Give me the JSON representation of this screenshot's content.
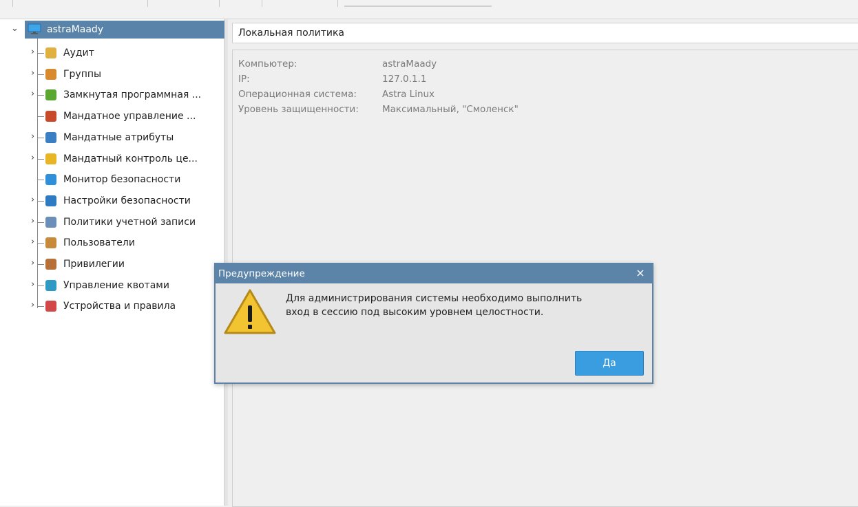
{
  "sidebar": {
    "root_label": "astraMaady",
    "items": [
      {
        "label": "Аудит",
        "icon": "audit-icon",
        "expandable": true,
        "color": "#e0b040"
      },
      {
        "label": "Группы",
        "icon": "groups-icon",
        "expandable": true,
        "color": "#d88a2e"
      },
      {
        "label": "Замкнутая программная ...",
        "icon": "closed-software-icon",
        "expandable": true,
        "color": "#5aa832"
      },
      {
        "label": "Мандатное управление ...",
        "icon": "mandatory-control-icon",
        "expandable": false,
        "color": "#c94a2a"
      },
      {
        "label": "Мандатные атрибуты",
        "icon": "mandatory-attributes-icon",
        "expandable": true,
        "color": "#3a7fc4"
      },
      {
        "label": "Мандатный контроль це...",
        "icon": "integrity-control-icon",
        "expandable": true,
        "color": "#e8b524"
      },
      {
        "label": "Монитор безопасности",
        "icon": "security-monitor-icon",
        "expandable": false,
        "color": "#2f8fd8"
      },
      {
        "label": "Настройки безопасности",
        "icon": "security-settings-icon",
        "expandable": true,
        "color": "#2e7bc4"
      },
      {
        "label": "Политики учетной записи",
        "icon": "account-policy-icon",
        "expandable": true,
        "color": "#6a8fb8"
      },
      {
        "label": "Пользователи",
        "icon": "users-icon",
        "expandable": true,
        "color": "#c78a3a"
      },
      {
        "label": "Привилегии",
        "icon": "privileges-icon",
        "expandable": true,
        "color": "#b7703a"
      },
      {
        "label": "Управление квотами",
        "icon": "quota-icon",
        "expandable": true,
        "color": "#2f9ac4"
      },
      {
        "label": "Устройства и правила",
        "icon": "devices-rules-icon",
        "expandable": true,
        "color": "#d04848"
      }
    ]
  },
  "main": {
    "title": "Локальная политика",
    "info": [
      {
        "label": "Компьютер:",
        "value": "astraMaady"
      },
      {
        "label": "IP:",
        "value": "127.0.1.1"
      },
      {
        "label": "Операционная система:",
        "value": "Astra Linux"
      },
      {
        "label": "Уровень защищенности:",
        "value": "Максимальный, \"Смоленск\""
      }
    ]
  },
  "dialog": {
    "title": "Предупреждение",
    "close": "×",
    "message_line1": "Для администрирования системы необходимо выполнить",
    "message_line2": "вход в сессию под высоким уровнем целостности.",
    "ok_label": "Да"
  }
}
